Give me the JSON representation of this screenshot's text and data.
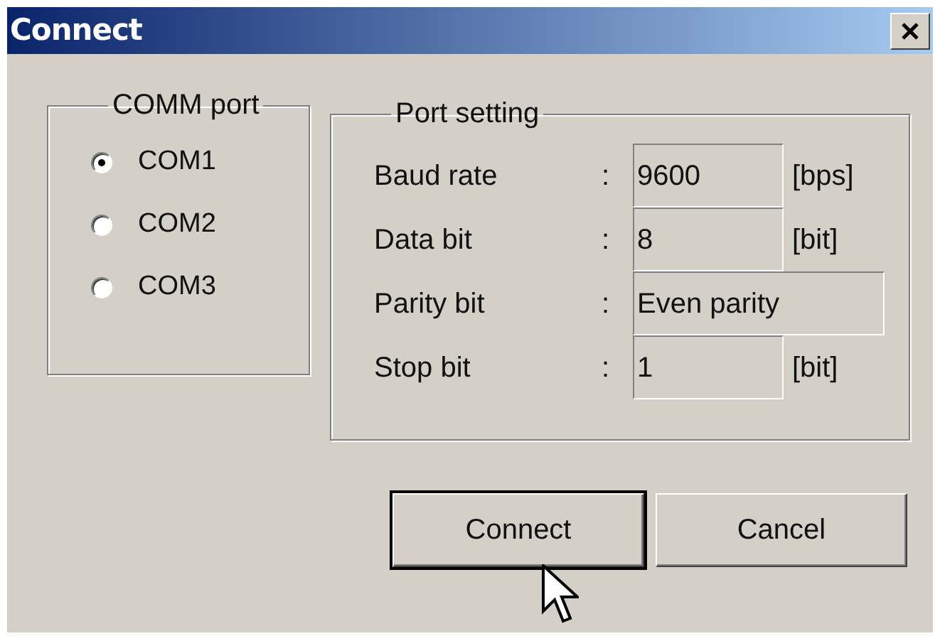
{
  "window": {
    "title": "Connect"
  },
  "comm_port": {
    "title": "COMM port",
    "options": [
      {
        "label": "COM1",
        "selected": true
      },
      {
        "label": "COM2",
        "selected": false
      },
      {
        "label": "COM3",
        "selected": false
      }
    ]
  },
  "port_setting": {
    "title": "Port setting",
    "rows": [
      {
        "label": "Baud rate",
        "separator": ":",
        "value": "9600",
        "unit": "[bps]"
      },
      {
        "label": "Data bit",
        "separator": ":",
        "value": "8",
        "unit": "[bit]"
      },
      {
        "label": "Parity bit",
        "separator": ":",
        "value": "Even parity"
      },
      {
        "label": "Stop bit",
        "separator": ":",
        "value": "1",
        "unit": "[bit]"
      }
    ]
  },
  "buttons": [
    {
      "label": "Connect",
      "default": true
    },
    {
      "label": "Cancel",
      "default": false
    }
  ]
}
